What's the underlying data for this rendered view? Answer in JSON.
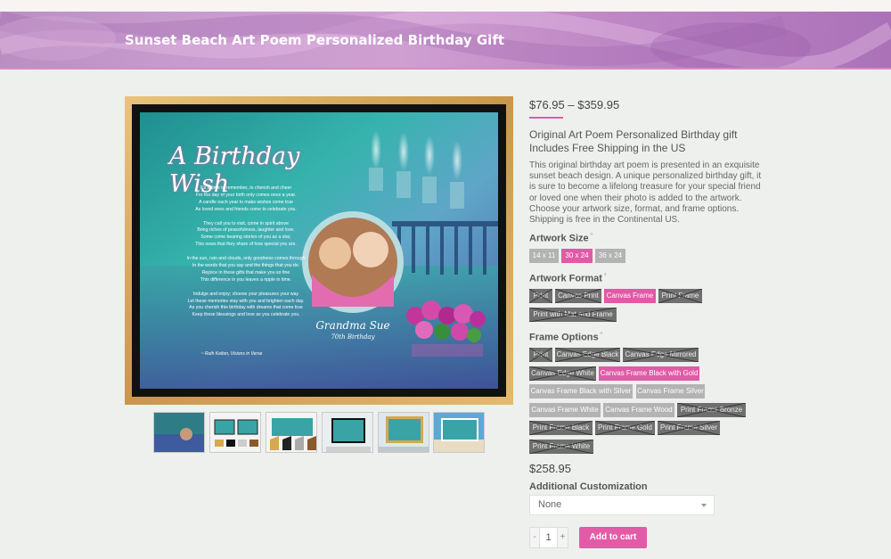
{
  "header": {
    "title": "Sunset Beach Art Poem Personalized Birthday Gift"
  },
  "artwork": {
    "heading": "A Birthday Wish",
    "poem": [
      "It's a time to remember, to cherish and cheer",
      "For the day of your birth only comes once a year.",
      "A candle each year to make wishes come true",
      "As loved ones and friends come to celebrate you.",
      "",
      "They call you to visit, come in spirit above",
      "Bring riches of peacefulness, laughter and love.",
      "Some come bearing stories of you as a star,",
      "This news that they share of how special you are.",
      "",
      "In the sun, rain and clouds, only goodness comes through",
      "In the words that you say and the things that you do.",
      "Rejoice in these gifts that make you so fine",
      "This difference in you leaves a ripple in time.",
      "",
      "Indulge and enjoy; choose your pleasures your way",
      "Let these memories stay with you and brighten each day.",
      "As you cherish this birthday with dreams that come true",
      "Keep these blessings and love as you celebrate you."
    ],
    "signature": "~ Ruth Kelton, Visions in Verse",
    "name": "Grandma Sue",
    "occasion": "70th Birthday"
  },
  "product": {
    "price_range": "$76.95 – $359.95",
    "subtitle": "Original Art Poem Personalized Birthday gift Includes Free Shipping in the US",
    "description": "This original birthday art poem is presented in an exquisite sunset beach design. A unique personalized birthday gift, it is sure to become a lifelong treasure for your special friend or loved one when their photo is added to the artwork. Choose your artwork size, format, and frame options. Shipping is free in the Continental US.",
    "price": "$258.95"
  },
  "options": {
    "size": {
      "label": "Artwork Size",
      "items": [
        "14 x 11",
        "30 x 24",
        "36 x 24"
      ],
      "selected": "30 x 24"
    },
    "format": {
      "label": "Artwork Format",
      "items": [
        "Print",
        "Canvas Print",
        "Canvas Frame",
        "Print Frame",
        "Print with Mat and Frame"
      ],
      "selected": "Canvas Frame"
    },
    "frame": {
      "label": "Frame Options",
      "items": [
        "Print",
        "Canvas Edge Black",
        "Canvas Edge Mirrored",
        "Canvas Edge White",
        "Canvas Frame Black with Gold",
        "Canvas Frame Black with Silver",
        "Canvas Frame Silver",
        "Canvas Frame White",
        "Canvas Frame Wood",
        "Print Frame Bronze",
        "Print Frame Black",
        "Print Frame Gold",
        "Print Frame Silver",
        "Print Frame White"
      ],
      "selected": "Canvas Frame Black with Gold"
    },
    "required_mark": "*"
  },
  "customization": {
    "label": "Additional Customization",
    "selected": "None"
  },
  "cart": {
    "minus": "-",
    "quantity": "1",
    "plus": "+",
    "button": "Add to cart"
  },
  "colors": {
    "accent": "#e05aa5",
    "banner": "#c79bcd",
    "frame_gold": "#d6a94c",
    "unavailable": "#6f6f6f"
  }
}
